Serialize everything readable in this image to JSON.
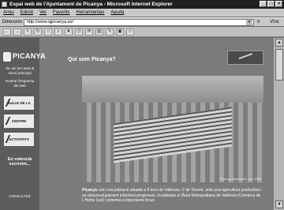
{
  "window": {
    "title": "Espai web de l'Ajuntament de Picanya - Microsoft Internet Explorer",
    "buttons": {
      "minimize": "_",
      "maximize": "□",
      "close": "×"
    }
  },
  "menu": [
    "Arxiu",
    "Edició",
    "Ver",
    "Favorits",
    "Herramientas",
    "Ayuda"
  ],
  "address": {
    "label": "Dirección",
    "url": "http://www.ajpicanya.es/",
    "go": "Ir",
    "links": "Vínc"
  },
  "toolbar": {
    "buttons": [
      "back-icon",
      "forward-icon",
      "stop-icon",
      "refresh-icon",
      "home-icon",
      "search-icon",
      "favorites-icon",
      "history-icon",
      "mail-icon",
      "print-icon",
      "edit-icon",
      "discuss-icon",
      "messenger-icon"
    ]
  },
  "sidebar": {
    "logo_text": "PICANYA",
    "home_link": "clic ací per anar al menú principal",
    "map_link": "mostrar l'esquema del web",
    "items": [
      "BULLE DE LA VILA",
      "CENTRE",
      "ACTIVITATS"
    ],
    "footer_text": "En valencià escrivim...",
    "footer_sub": "CONSULTES"
  },
  "content": {
    "title": "Qui som Picanya?",
    "photo_caption": "Picanya vista aèria, any 1995",
    "body_strong": "Picanya",
    "body_text": " com una població situada a 6 kms de València i 2 de Torrent, amb una agricultura productiva i un desenvolupament industrial progressiu, localitzada a l'Àrea Metropolitana de València (Comarca de L'Horta Sud) i pròxima a importants focus"
  },
  "colors": {
    "page_bg": "#7b7b7b",
    "sidebar_bg": "#5c5c5c",
    "titlebar_bg": "#202020",
    "chrome_bg": "#c9c9c9"
  }
}
